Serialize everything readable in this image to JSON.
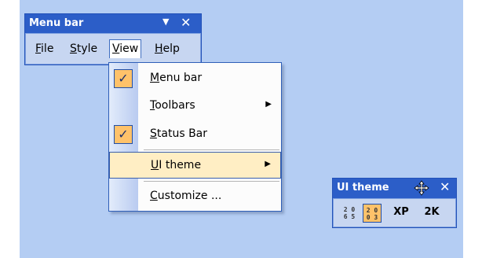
{
  "menu_toolbar": {
    "title": "Menu bar",
    "dropdown_glyph": "▼",
    "close_glyph": "✕",
    "menus": [
      {
        "label_u": "F",
        "label_rest": "ile"
      },
      {
        "label_u": "S",
        "label_rest": "tyle"
      },
      {
        "label_u": "V",
        "label_rest": "iew"
      },
      {
        "label_u": "H",
        "label_rest": "elp"
      }
    ],
    "open_menu": "View"
  },
  "view_menu": {
    "items": [
      {
        "label_u": "M",
        "label_rest": "enu bar",
        "checked": true
      },
      {
        "label_u": "T",
        "label_rest": "oolbars",
        "submenu": true
      },
      {
        "label_u": "S",
        "label_rest": "tatus Bar",
        "checked": true
      },
      {
        "label_u": "U",
        "label_rest": "I theme",
        "submenu": true,
        "highlighted": true
      },
      {
        "label_u": "C",
        "label_rest": "ustomize ..."
      }
    ],
    "check_glyph": "✓",
    "submenu_glyph": "▶"
  },
  "theme_toolbar": {
    "title": "UI theme",
    "close_glyph": "✕",
    "icons": [
      "move-icon"
    ],
    "buttons": [
      {
        "kind": "digits",
        "top": "2 0",
        "bottom": "6 5",
        "active": false
      },
      {
        "kind": "digits",
        "top": "2 0",
        "bottom": "0 3",
        "active": true
      },
      {
        "kind": "text",
        "label": "XP",
        "active": false
      },
      {
        "kind": "text",
        "label": "2K",
        "active": false
      }
    ]
  },
  "colors": {
    "background": "#b4cdf3",
    "titlebar": "#2c5ec8",
    "active_accent": "#ffc26a",
    "hover_item": "#ffeec4"
  }
}
